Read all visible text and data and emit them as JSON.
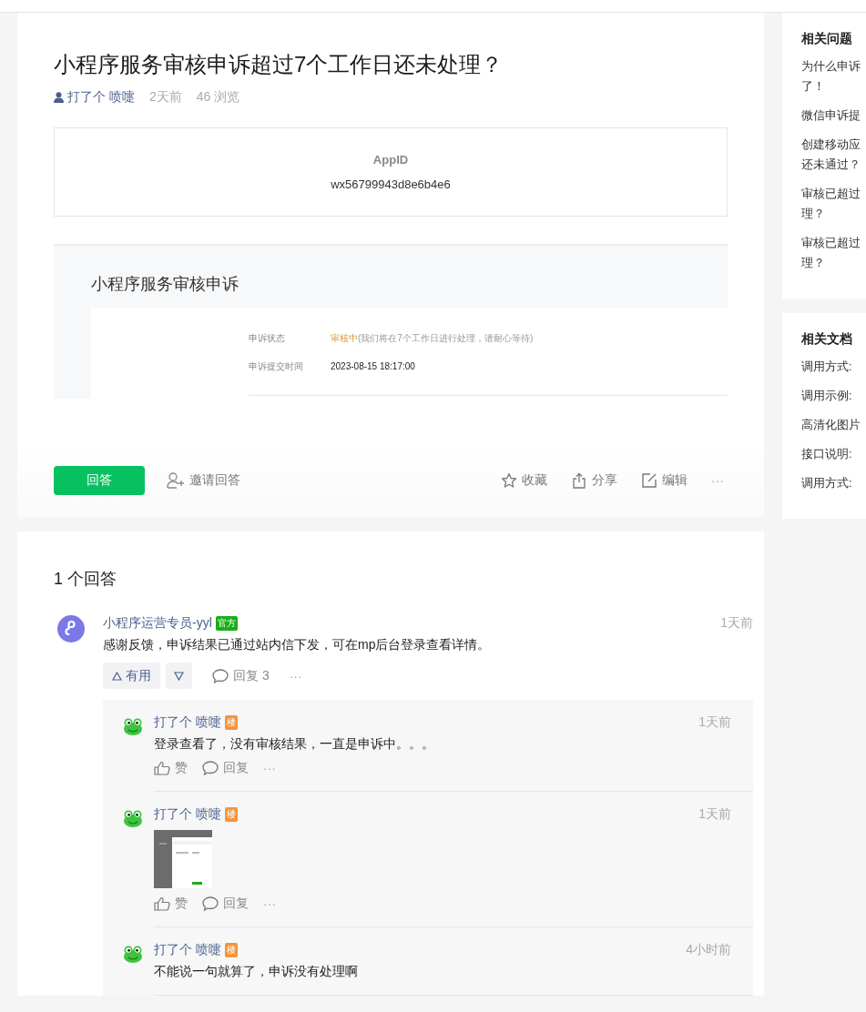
{
  "question": {
    "title": "小程序服务审核申诉超过7个工作日还未处理？",
    "author": "打了个 喷嚏",
    "time": "2天前",
    "views": "46 浏览",
    "appid_label": "AppID",
    "appid": "wx56799943d8e6b4e6",
    "appeal": {
      "heading": "小程序服务审核申诉",
      "rows": [
        {
          "label": "申诉状态",
          "status": "审核中",
          "value": "(我们将在7个工作日进行处理，请耐心等待)"
        },
        {
          "label": "申诉提交时间",
          "status": "",
          "value": "2023-08-15 18:17:00"
        }
      ]
    },
    "answer_button": "回答",
    "invite": "邀请回答",
    "actions": [
      {
        "kind": "star",
        "label": "收藏"
      },
      {
        "kind": "share",
        "label": "分享"
      },
      {
        "kind": "edit",
        "label": "编辑"
      }
    ],
    "more": "···"
  },
  "answers": {
    "count": "1 个回答",
    "items": [
      {
        "author": "小程序运营专员-yyl",
        "badge": {
          "kind": "official",
          "text": "官方"
        },
        "time": "1天前",
        "text": "感谢反馈，申诉结果已通过站内信下发，可在mp后台登录查看详情。",
        "useful": "有用",
        "reply": "回复 3",
        "more": "···",
        "replies": [
          {
            "author": "打了个 喷嚏",
            "badge": {
              "kind": "author",
              "text": "楼"
            },
            "time": "1天前",
            "kind": "text",
            "text": "登录查看了，没有审核结果，一直是申诉中。。。",
            "like": "赞",
            "reply": "回复",
            "more": "···"
          },
          {
            "author": "打了个 喷嚏",
            "badge": {
              "kind": "author",
              "text": "楼"
            },
            "time": "1天前",
            "kind": "picture",
            "like": "赞",
            "reply": "回复",
            "more": "···"
          },
          {
            "author": "打了个 喷嚏",
            "badge": {
              "kind": "author",
              "text": "楼"
            },
            "time": "4小时前",
            "kind": "text",
            "text": "不能说一句就算了，申诉没有处理啊"
          }
        ]
      }
    ]
  },
  "sidebar": [
    {
      "title": "相关问题",
      "items": [
        "为什么申诉了！",
        "微信申诉提",
        "创建移动应还未通过？",
        "审核已超过理？",
        "审核已超过理？"
      ]
    },
    {
      "title": "相关文档",
      "items": [
        "调用方式:",
        "调用示例:",
        "高清化图片",
        "接口说明:",
        "调用方式:"
      ]
    }
  ]
}
